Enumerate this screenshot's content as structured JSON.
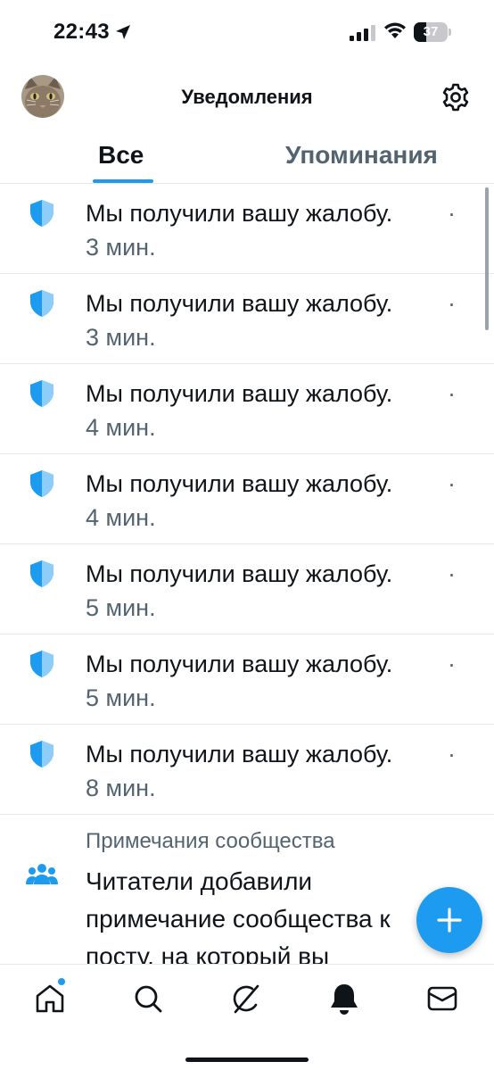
{
  "status_bar": {
    "time": "22:43",
    "battery_level": "37",
    "battery_percent": 37,
    "icons": [
      "location-arrow-icon",
      "signal-icon",
      "wifi-icon",
      "battery-icon"
    ]
  },
  "header": {
    "title": "Уведомления",
    "avatar_icon": "avatar",
    "settings_icon": "gear-icon"
  },
  "tabs": [
    {
      "label": "Все",
      "active": true
    },
    {
      "label": "Упоминания",
      "active": false
    }
  ],
  "notifications": [
    {
      "icon": "shield-icon",
      "text": "Мы получили вашу жалобу.",
      "separator": "·",
      "time": "3 мин."
    },
    {
      "icon": "shield-icon",
      "text": "Мы получили вашу жалобу.",
      "separator": "·",
      "time": "3 мин."
    },
    {
      "icon": "shield-icon",
      "text": "Мы получили вашу жалобу.",
      "separator": "·",
      "time": "4 мин."
    },
    {
      "icon": "shield-icon",
      "text": "Мы получили вашу жалобу.",
      "separator": "·",
      "time": "4 мин."
    },
    {
      "icon": "shield-icon",
      "text": "Мы получили вашу жалобу.",
      "separator": "·",
      "time": "5 мин."
    },
    {
      "icon": "shield-icon",
      "text": "Мы получили вашу жалобу.",
      "separator": "·",
      "time": "5 мин."
    },
    {
      "icon": "shield-icon",
      "text": "Мы получили вашу жалобу.",
      "separator": "·",
      "time": "8 мин."
    }
  ],
  "community_note": {
    "icon": "people-icon",
    "category": "Примечания сообщества",
    "text": "Читатели добавили примечание сообщества к посту, на который вы"
  },
  "fab": {
    "icon": "plus-icon"
  },
  "bottom_nav": [
    {
      "name": "home",
      "icon": "home-icon",
      "has_badge": true
    },
    {
      "name": "search",
      "icon": "search-icon",
      "has_badge": false
    },
    {
      "name": "grok",
      "icon": "grok-icon",
      "has_badge": false
    },
    {
      "name": "notifications",
      "icon": "bell-icon",
      "has_badge": false,
      "active": true
    },
    {
      "name": "messages",
      "icon": "mail-icon",
      "has_badge": false
    }
  ],
  "colors": {
    "accent": "#1d9bf0",
    "text_primary": "#0f1419",
    "text_secondary": "#536471",
    "divider": "#e6e9ec"
  }
}
